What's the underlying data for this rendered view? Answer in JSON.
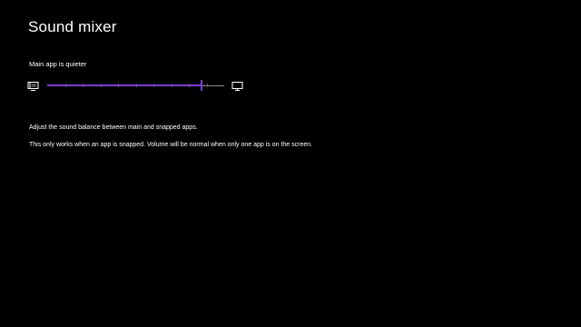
{
  "page": {
    "title": "Sound mixer"
  },
  "mixer": {
    "label": "Main app is quieter",
    "left_icon": "snapped-app-icon",
    "right_icon": "main-app-icon",
    "value": 0.87,
    "tick_count": 9,
    "accent_color": "#7b3fd6"
  },
  "info": {
    "line1": "Adjust the sound balance between main and snapped apps.",
    "line2": "This only works when an app is snapped. Volume will be normal when only one app is on the screen."
  }
}
